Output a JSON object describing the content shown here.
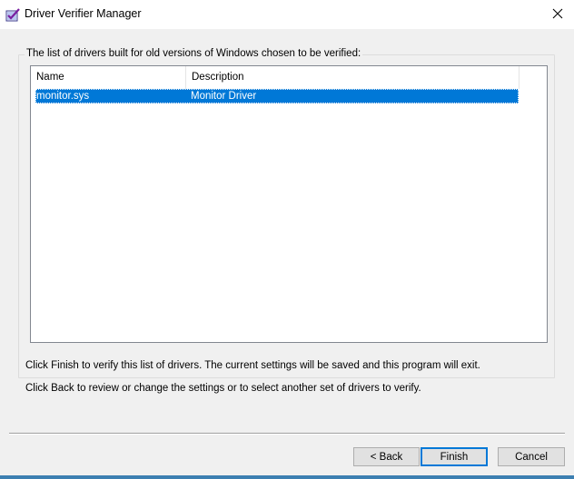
{
  "window": {
    "title": "Driver Verifier Manager"
  },
  "group": {
    "label": "The list of drivers built for old versions of Windows chosen to be verified:"
  },
  "list": {
    "columns": [
      "Name",
      "Description"
    ],
    "rows": [
      {
        "name": "monitor.sys",
        "description": "Monitor Driver"
      }
    ]
  },
  "info": {
    "line1": "Click Finish to verify this list of drivers. The current settings will be saved and this program will exit.",
    "line2": "Click Back to review or change the settings or to select another set of drivers to verify."
  },
  "buttons": {
    "back": "< Back",
    "finish": "Finish",
    "cancel": "Cancel"
  },
  "icons": {
    "app": "driver-verifier-checkmark-icon",
    "close": "close-icon"
  },
  "colors": {
    "selection": "#0078d7",
    "titlebar": "#ffffff",
    "dialog_bg": "#f0f0f0",
    "default_button_border": "#0078d7"
  }
}
